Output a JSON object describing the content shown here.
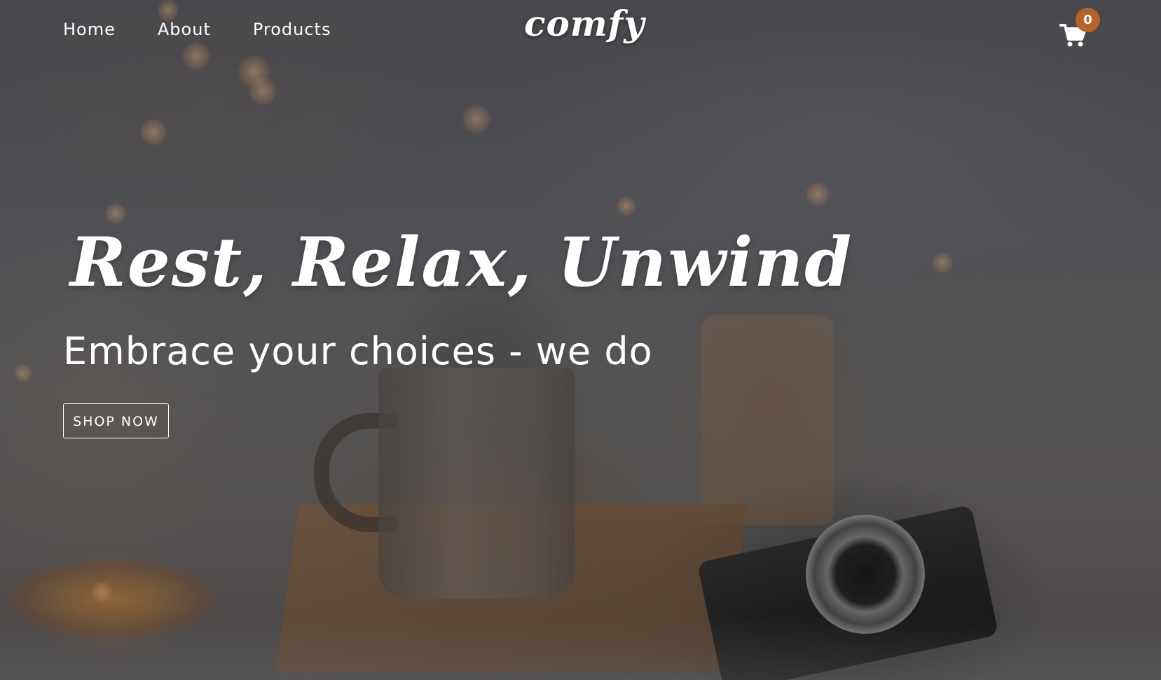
{
  "nav": {
    "links": [
      {
        "label": "Home"
      },
      {
        "label": "About"
      },
      {
        "label": "Products"
      }
    ],
    "logo": "comfy",
    "cart": {
      "icon": "cart-icon",
      "count": "0",
      "badge_color": "#b7632a"
    }
  },
  "hero": {
    "title": "Rest, Relax, Unwind",
    "subtitle": "Embrace your choices - we do",
    "cta_label": "SHOP NOW"
  },
  "theme": {
    "text_color": "#ffffff",
    "accent": "#b7632a"
  }
}
